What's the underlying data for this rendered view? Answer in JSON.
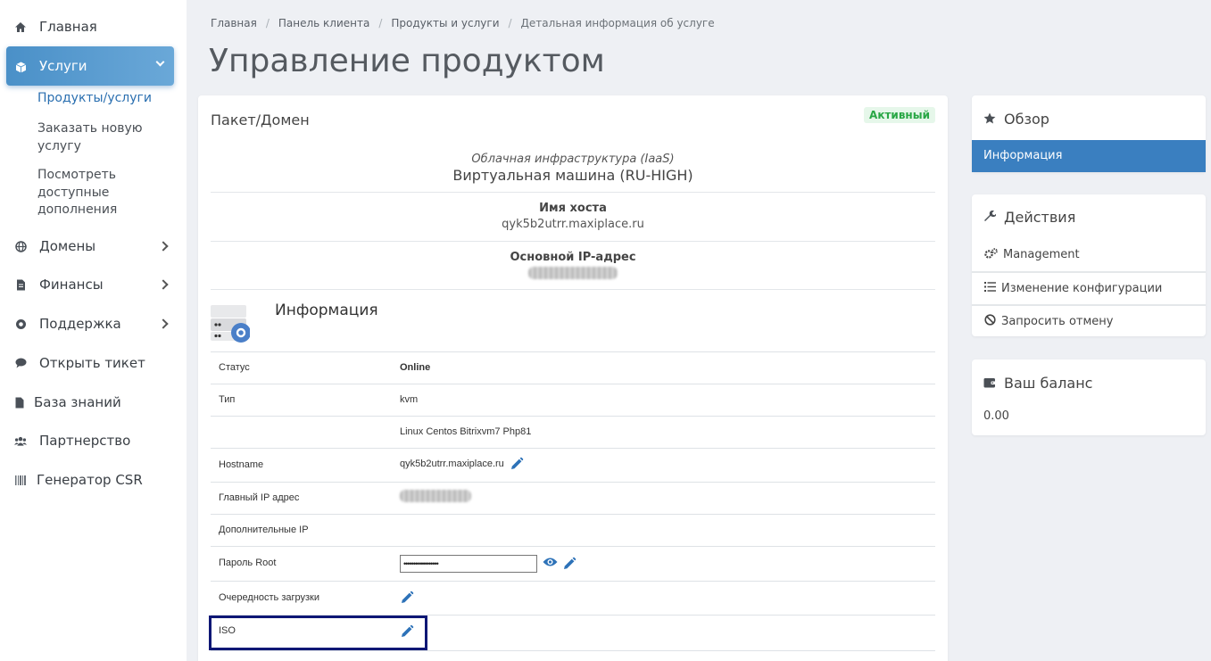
{
  "sidebar": {
    "items": [
      {
        "label": "Главная",
        "icon": "home-icon"
      },
      {
        "label": "Услуги",
        "icon": "cube-icon",
        "active": true
      },
      {
        "label": "Домены",
        "icon": "globe-icon"
      },
      {
        "label": "Финансы",
        "icon": "document-icon"
      },
      {
        "label": "Поддержка",
        "icon": "lifebuoy-icon"
      },
      {
        "label": "Открыть тикет",
        "icon": "comment-icon"
      },
      {
        "label": "База знаний",
        "icon": "file-icon"
      },
      {
        "label": "Партнерство",
        "icon": "users-icon"
      },
      {
        "label": "Генератор CSR",
        "icon": "barcode-icon"
      }
    ],
    "sub_items": [
      {
        "label": "Продукты/услуги",
        "current": true
      },
      {
        "label": "Заказать новую услугу"
      },
      {
        "label": "Посмотреть доступные дополнения"
      }
    ]
  },
  "breadcrumb": [
    "Главная",
    "Панель клиента",
    "Продукты и услуги",
    "Детальная информация об услуге"
  ],
  "page_title": "Управление продуктом",
  "package": {
    "title": "Пакет/Домен",
    "status_badge": "Активный",
    "category": "Облачная инфраструктура (IaaS)",
    "product": "Виртуальная машина (RU-HIGH)",
    "hostname_label": "Имя хоста",
    "hostname": "qyk5b2utrr.maxiplace.ru",
    "ip_label": "Основной IP-адрес"
  },
  "info": {
    "heading": "Информация",
    "rows": [
      {
        "key": "Статус",
        "value": "Online"
      },
      {
        "key": "Тип",
        "value": "kvm"
      },
      {
        "key": "",
        "value": "Linux Centos Bitrixvm7 Php81"
      },
      {
        "key": "Hostname",
        "value": "qyk5b2utrr.maxiplace.ru"
      },
      {
        "key": "Главный IP адрес",
        "value": ""
      },
      {
        "key": "Дополнительные IP",
        "value": ""
      },
      {
        "key": "Пароль Root",
        "value": "••••••••••••••••••"
      },
      {
        "key": "Очередность загрузки",
        "value": ""
      },
      {
        "key": "ISO",
        "value": ""
      }
    ]
  },
  "overview": {
    "title": "Обзор",
    "active_link": "Информация"
  },
  "actions": {
    "title": "Действия",
    "links": [
      "Management",
      "Изменение конфигурации",
      "Запросить отмену"
    ]
  },
  "balance": {
    "title": "Ваш баланс",
    "amount": "0.00"
  },
  "colors": {
    "accent": "#3a7fc0",
    "online": "#1e8c1e",
    "badge_green": "#29a745",
    "focus_outline": "#0e1775"
  }
}
